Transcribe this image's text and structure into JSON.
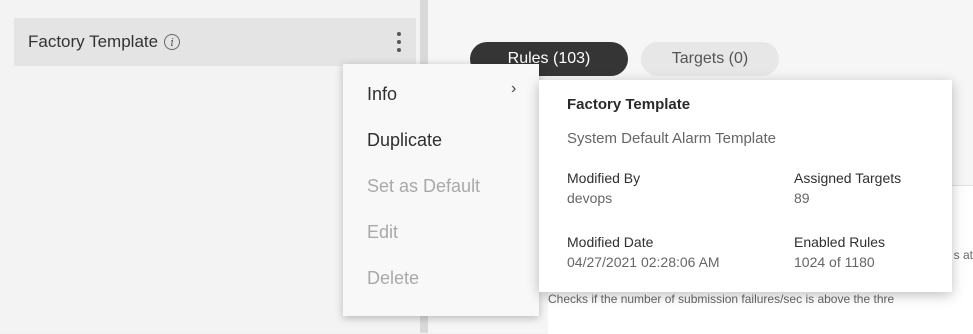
{
  "sidebar": {
    "template_name": "Factory Template",
    "info_icon": "info-circle-icon",
    "more_icon": "kebab-menu-icon"
  },
  "tabs": [
    {
      "label": "Rules (103)"
    },
    {
      "label": "Targets (0)"
    }
  ],
  "content": {
    "rule_description": "Checks if the number of submission failures/sec is above the thre",
    "partial_text": "s at"
  },
  "context_menu": {
    "items": [
      {
        "label": "Info",
        "enabled": true
      },
      {
        "label": "Duplicate",
        "enabled": true
      },
      {
        "label": "Set as Default",
        "enabled": false
      },
      {
        "label": "Edit",
        "enabled": false
      },
      {
        "label": "Delete",
        "enabled": false
      }
    ],
    "submenu_icon": "chevron-right-icon"
  },
  "info_popover": {
    "title": "Factory Template",
    "subtitle": "System Default Alarm Template",
    "modified_by_label": "Modified By",
    "modified_by_value": "devops",
    "assigned_targets_label": "Assigned Targets",
    "assigned_targets_value": "89",
    "modified_date_label": "Modified Date",
    "modified_date_value": "04/27/2021 02:28:06 AM",
    "enabled_rules_label": "Enabled Rules",
    "enabled_rules_value": "1024 of 1180"
  },
  "colors": {
    "active_tab": "#353535",
    "inactive_tab": "#e7e7e7",
    "disabled_text": "#a9a9a9"
  }
}
